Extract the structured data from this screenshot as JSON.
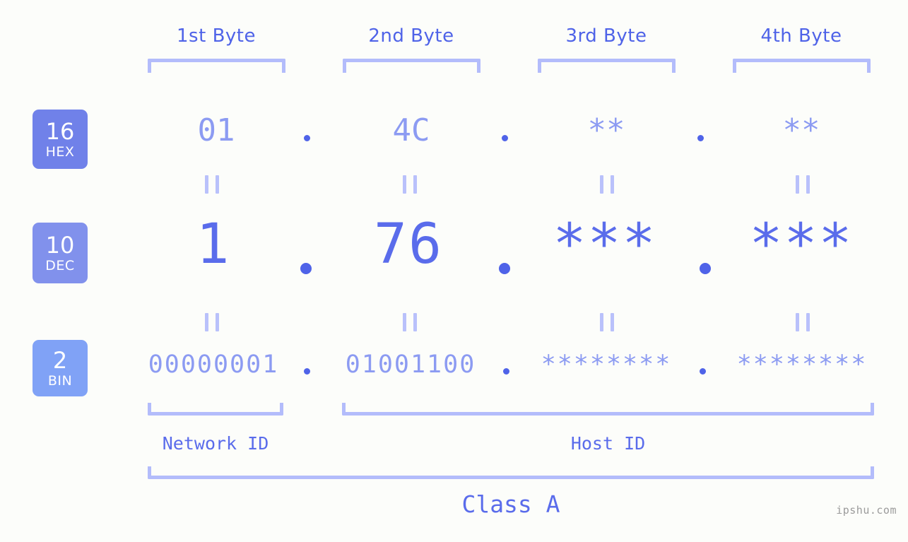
{
  "watermark": "ipshu.com",
  "headers": [
    {
      "label": "1st Byte"
    },
    {
      "label": "2nd Byte"
    },
    {
      "label": "3rd Byte"
    },
    {
      "label": "4th Byte"
    }
  ],
  "bases": [
    {
      "number": "16",
      "name": "HEX",
      "color": "#7081e9"
    },
    {
      "number": "10",
      "name": "DEC",
      "color": "#8191ec"
    },
    {
      "number": "2",
      "name": "BIN",
      "color": "#80a2f6"
    }
  ],
  "rows": {
    "hex": {
      "base": "16",
      "base_name": "HEX",
      "bytes": [
        "01",
        "4C",
        "**",
        "**"
      ],
      "separator": "."
    },
    "dec": {
      "base": "10",
      "base_name": "DEC",
      "bytes": [
        "1",
        "76",
        "***",
        "***"
      ],
      "separator": "."
    },
    "bin": {
      "base": "2",
      "base_name": "BIN",
      "bytes": [
        "00000001",
        "01001100",
        "********",
        "********"
      ],
      "separator": "."
    }
  },
  "segments": {
    "network_id": "Network ID",
    "host_id": "Host ID",
    "class": "Class A"
  },
  "ip": {
    "decimal": "1.76.***.***",
    "hex": "01.4C.**.**",
    "binary": "00000001.01001100.********.********",
    "class": "A"
  },
  "colors": {
    "background": "#fcfdfa",
    "header_text": "#4f63e8",
    "bracket": "#b3bcfb",
    "value_strong": "#5a6ceb",
    "value_light": "#8c9bf2",
    "equals_mark": "#b9c1fb",
    "watermark": "#9b9b9b"
  }
}
